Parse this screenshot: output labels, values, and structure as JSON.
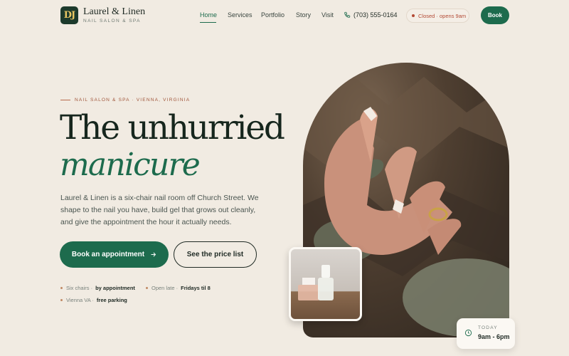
{
  "brand": {
    "monogram": "DJ",
    "name": "Laurel & Linen",
    "tagline": "NAIL SALON & SPA"
  },
  "nav": {
    "items": [
      "Home",
      "Services",
      "Portfolio",
      "Story",
      "Visit"
    ],
    "active": "Home"
  },
  "header": {
    "phone": "(703) 555-0164",
    "status": "Closed · opens 9am",
    "book_label": "Book"
  },
  "hero": {
    "eyebrow": "NAIL SALON & SPA · VIENNA, VIRGINIA",
    "title_line1": "The unhurried",
    "title_line2": "manicure",
    "description": "Laurel & Linen is a six-chair nail room off Church Street. We shape to the nail you have, build gel that grows out cleanly, and give the appointment the hour it actually needs.",
    "cta_primary": "Book an appointment",
    "cta_secondary": "See the price list"
  },
  "meta": [
    {
      "label": "Six chairs ·",
      "value": "by appointment"
    },
    {
      "label": "Open late ·",
      "value": "Fridays til 8"
    },
    {
      "label": "Vienna VA ·",
      "value": "free parking"
    }
  ],
  "today": {
    "label": "TODAY",
    "hours": "9am - 6pm"
  },
  "colors": {
    "accent": "#1d6b4d",
    "background": "#f1ebe2",
    "status": "#b34a35",
    "dark": "#16261d"
  }
}
